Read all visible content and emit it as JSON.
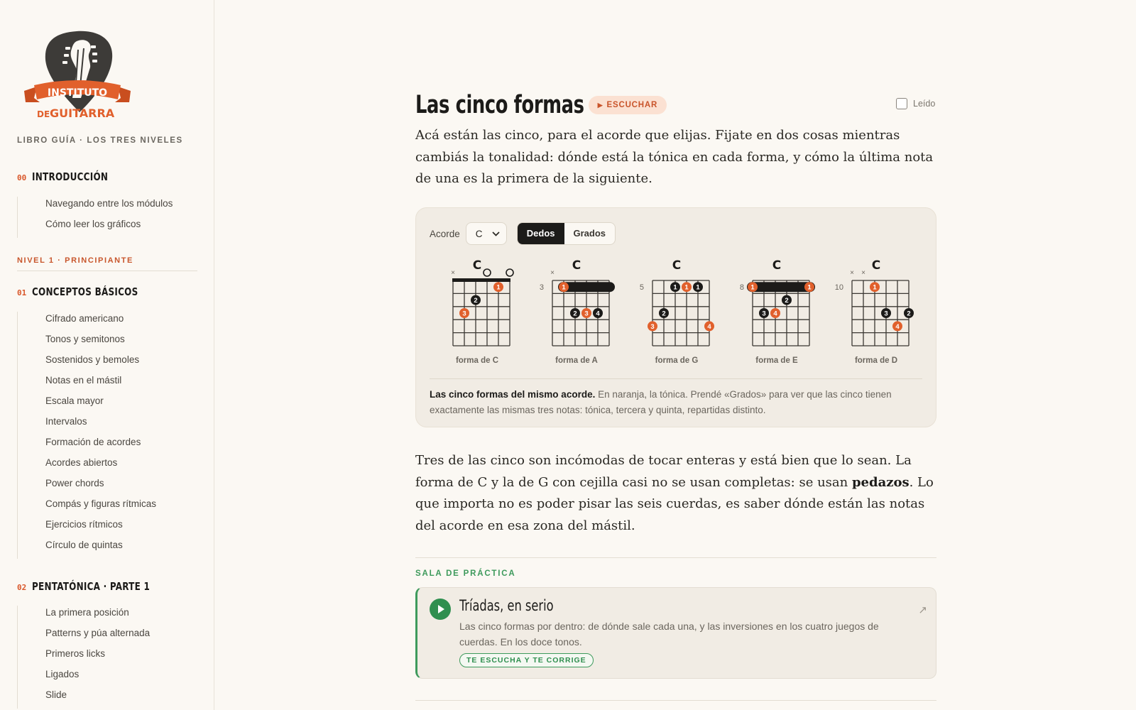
{
  "brand": {
    "logo_top": "INSTITUTO",
    "logo_de": "DE",
    "logo_bottom": "GUITARRA",
    "libro": "LIBRO GUÍA · LOS TRES NIVELES",
    "orange": "#e1602c"
  },
  "sidebar": {
    "intro": {
      "num": "00",
      "title": "INTRODUCCIÓN",
      "items": [
        "Navegando entre los módulos",
        "Cómo leer los gráficos"
      ]
    },
    "level1": "NIVEL 1 · PRINCIPIANTE",
    "conceptos": {
      "num": "01",
      "title": "CONCEPTOS BÁSICOS",
      "items": [
        "Cifrado americano",
        "Tonos y semitonos",
        "Sostenidos y bemoles",
        "Notas en el mástil",
        "Escala mayor",
        "Intervalos",
        "Formación de acordes",
        "Acordes abiertos",
        "Power chords",
        "Compás y figuras rítmicas",
        "Ejercicios rítmicos",
        "Círculo de quintas"
      ]
    },
    "pentatonica": {
      "num": "02",
      "title": "PENTATÓNICA · PARTE 1",
      "items": [
        "La primera posición",
        "Patterns y púa alternada",
        "Primeros licks",
        "Ligados",
        "Slide"
      ]
    }
  },
  "main": {
    "title": "Las cinco formas",
    "listen": "ESCUCHAR",
    "read": "Leído",
    "intro": "Acá están las cinco, para el acorde que elijas. Fijate en dos cosas mientras cambiás la tonalidad: dónde está la tónica en cada forma, y cómo la última nota de una es la primera de la siguiente.",
    "panel": {
      "acorde_label": "Acorde",
      "selected": "C",
      "mode_fingers": "Dedos",
      "mode_degrees": "Grados",
      "chords": [
        {
          "name": "C",
          "shape": "forma de C",
          "fret": ""
        },
        {
          "name": "C",
          "shape": "forma de A",
          "fret": "3"
        },
        {
          "name": "C",
          "shape": "forma de G",
          "fret": "5"
        },
        {
          "name": "C",
          "shape": "forma de E",
          "fret": "8"
        },
        {
          "name": "C",
          "shape": "forma de D",
          "fret": "10"
        }
      ],
      "caption_bold": "Las cinco formas del mismo acorde.",
      "caption": " En naranja, la tónica. Prendé «Grados» para ver que las cinco tienen exactamente las mismas tres notas: tónica, tercera y quinta, repartidas distinto."
    },
    "para2_a": "Tres de las cinco son incómodas de tocar enteras y está bien que lo sean. La forma de C y la de G con cejilla casi no se usan completas: se usan ",
    "para2_bold": "pedazos",
    "para2_b": ". Lo que importa no es poder pisar las seis cuerdas, es saber dónde están las notas del acorde en esa zona del mástil.",
    "sala": "SALA DE PRÁCTICA",
    "practice": {
      "title": "Tríadas, en serio",
      "desc": "Las cinco formas por dentro: de dónde sale cada una, y las inversiones en los cuatro juegos de cuerdas. En los doce tonos.",
      "badge": "TE ESCUCHA Y TE CORRIGE"
    }
  }
}
